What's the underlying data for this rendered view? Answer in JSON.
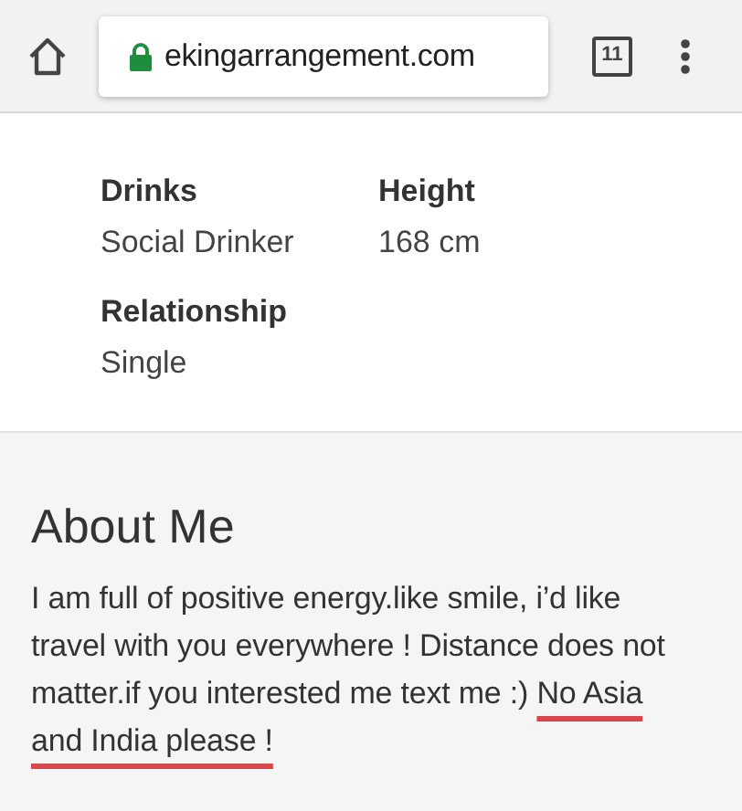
{
  "browser": {
    "url": "ekingarrangement.com",
    "tab_count": "11",
    "secure": true
  },
  "details": [
    {
      "label": "Drinks",
      "value": "Social Drinker"
    },
    {
      "label": "Height",
      "value": "168 cm"
    },
    {
      "label": "Relationship",
      "value": "Single"
    }
  ],
  "about": {
    "heading": "About Me",
    "text": "I am full of positive energy.like smile, i’d like travel with you everywhere ! Distance does not matter.if you interested me text me :) ",
    "highlight": {
      "text": "No Asia and India please !",
      "underlined": true
    }
  }
}
